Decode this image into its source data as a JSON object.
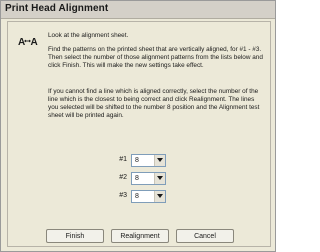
{
  "window": {
    "title": "Print Head Alignment"
  },
  "instructions": {
    "line1": "Look at the alignment sheet.",
    "line2": "Find the patterns on the printed sheet that are vertically aligned, for #1 - #3. Then select the number of those alignment patterns from the lists below and click Finish. This will make the new settings take effect.",
    "line3": "If you cannot find a line which is aligned correctly, select the number of the line which is the closest to being correct and click Realignment. The lines you selected will be shifted to the number 8 position and the Alignment test sheet will be printed again."
  },
  "logo": {
    "icon": "alignment-logo-icon",
    "label": "A↔A"
  },
  "selectors": [
    {
      "label": "#1",
      "value": "8"
    },
    {
      "label": "#2",
      "value": "8"
    },
    {
      "label": "#3",
      "value": "8"
    }
  ],
  "buttons": {
    "finish": "Finish",
    "realignment": "Realignment",
    "cancel": "Cancel"
  }
}
